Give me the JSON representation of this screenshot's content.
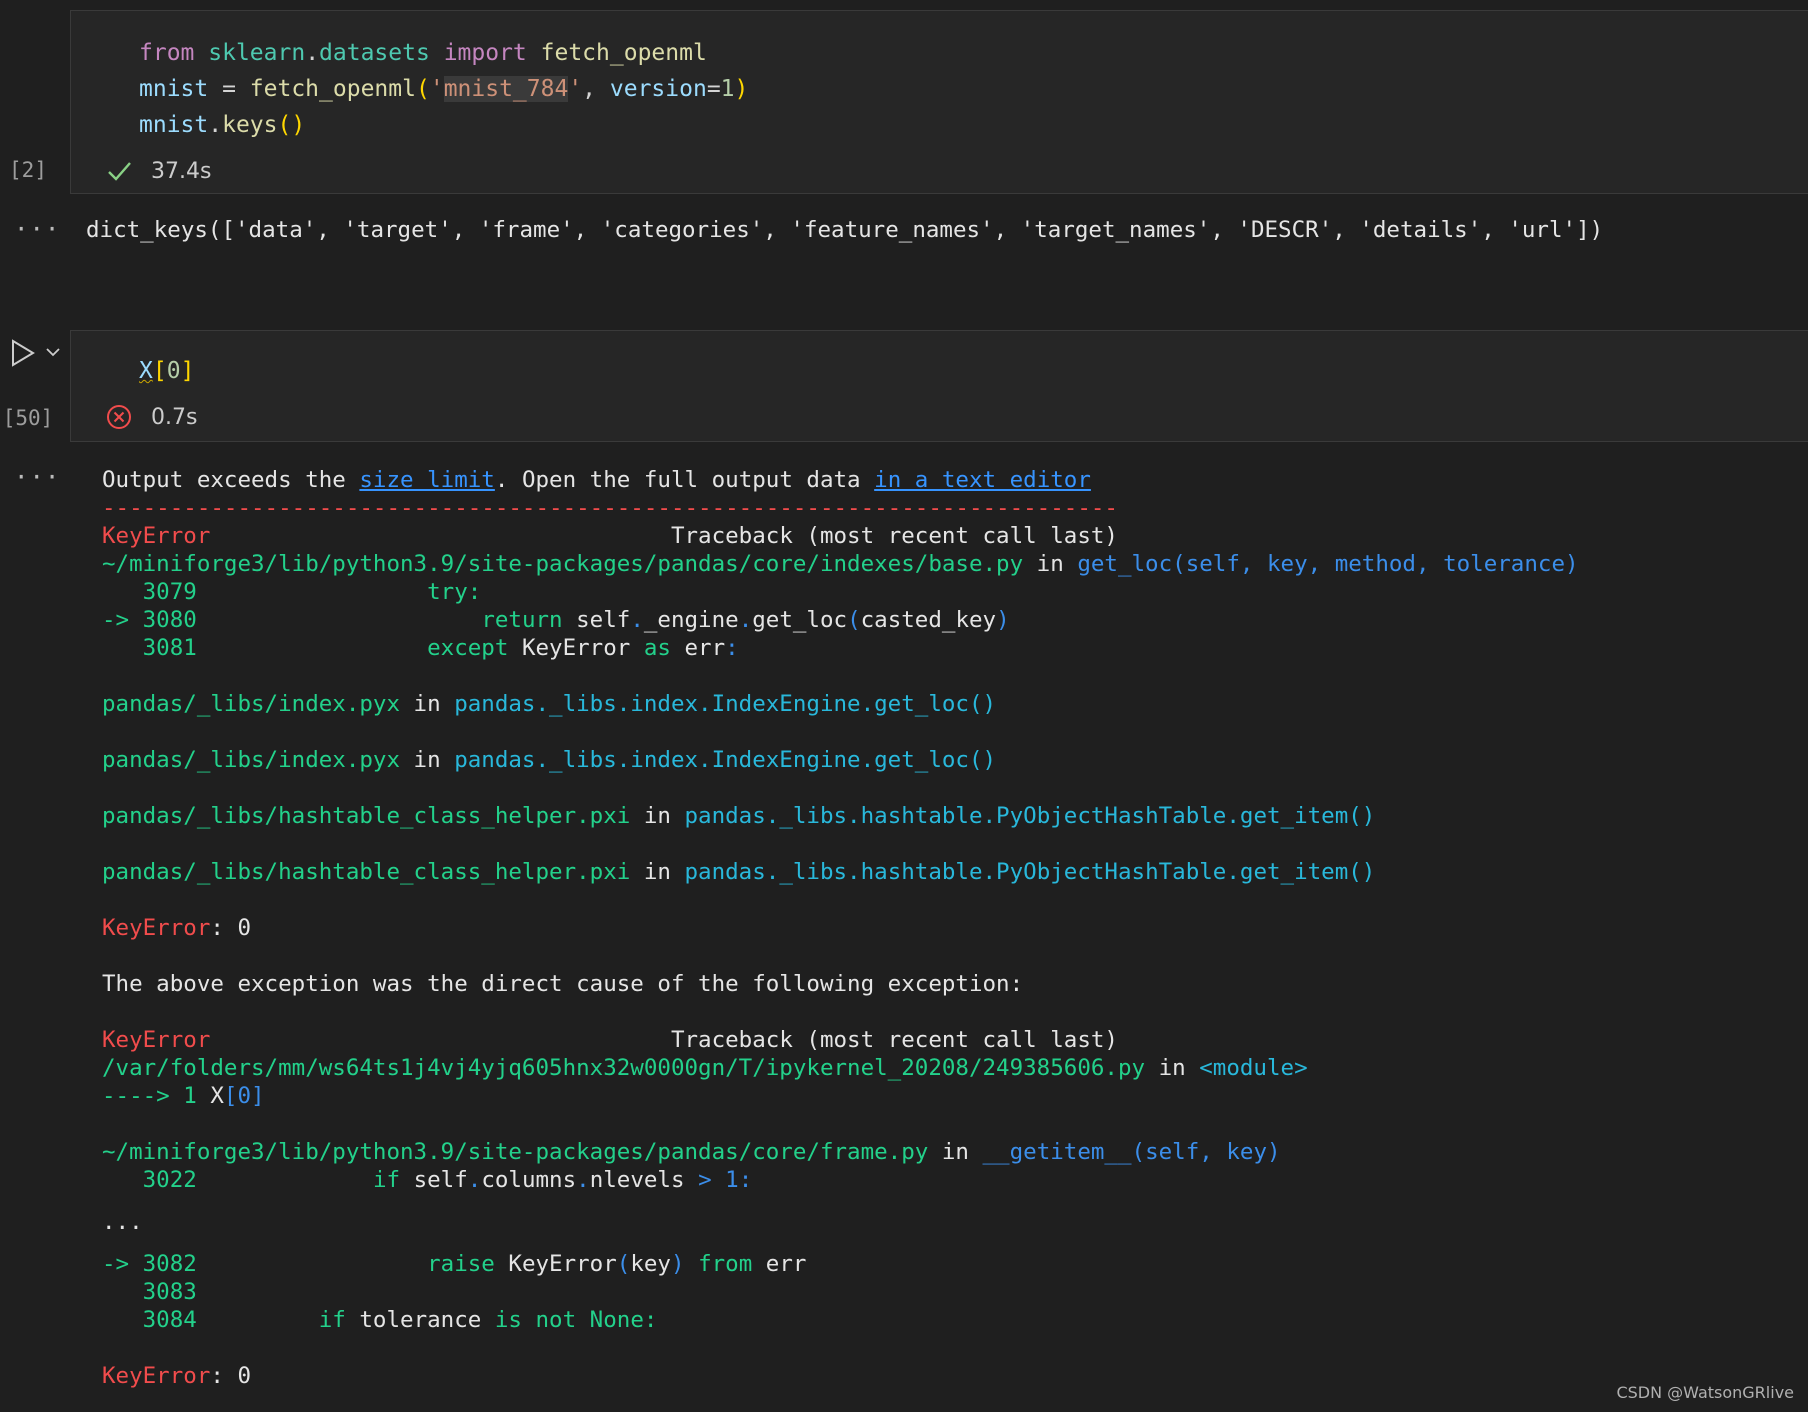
{
  "cell1": {
    "line1": {
      "from": "from",
      "module": "sklearn",
      "dot": ".",
      "sub": "datasets",
      "import": "import",
      "name": "fetch_openml"
    },
    "line2": {
      "var": "mnist",
      "eq": " = ",
      "fn": "fetch_openml",
      "open": "(",
      "quote1": "'",
      "arg": "mnist_784",
      "quote2": "'",
      "comma": ", ",
      "kwarg": "version",
      "eq2": "=",
      "num": "1",
      "close": ")"
    },
    "line3": {
      "var": "mnist",
      "dot": ".",
      "fn": "keys",
      "parens": "()"
    },
    "count": "[2]",
    "status_icon": "check-icon",
    "time": "37.4s"
  },
  "output1": {
    "ellipsis": "···",
    "text": "dict_keys(['data', 'target', 'frame', 'categories', 'feature_names', 'target_names', 'DESCR', 'details', 'url'])"
  },
  "cell2": {
    "code_x": "X",
    "code_bracket_open": "[",
    "code_num": "0",
    "code_bracket_close": "]",
    "count": "[50]",
    "status_icon": "error-circle-icon",
    "time": "0.7s",
    "run_icon": "play-icon",
    "chevron_icon": "chevron-down-icon"
  },
  "output2": {
    "ellipsis": "···",
    "notice": {
      "pre": "Output exceeds the ",
      "link1": "size limit",
      "mid": ". Open the full output data ",
      "link2": "in a text editor"
    },
    "separator": "---------------------------------------------------------------------------",
    "tb1": {
      "err": "KeyError",
      "gap": "                                  ",
      "head": "Traceback (most recent call last)"
    },
    "base_path": {
      "path": "~/miniforge3/lib/python3.9/site-packages/pandas/core/indexes/base.py",
      "in": " in ",
      "fn": "get_loc(self, key, method, tolerance)"
    },
    "l3079": {
      "num": "   3079",
      "gap": "                 ",
      "code": "try:"
    },
    "l3080": {
      "arrow": "-> 3080",
      "gap": "                     ",
      "kw": "return",
      "sp": " ",
      "obj": "self",
      "dot": ".",
      "attr": "_engine",
      "dot2": ".",
      "call": "get_loc",
      "open": "(",
      "arg": "casted_key",
      "close": ")"
    },
    "l3081": {
      "num": "   3081",
      "gap": "                 ",
      "kw": "except",
      "sp": " ",
      "name": "KeyError",
      "sp2": " ",
      "as": "as",
      "sp3": " ",
      "var": "err",
      "colon": ":"
    },
    "idx1": {
      "file": "pandas/_libs/index.pyx",
      "in": " in ",
      "fn": "pandas._libs.index.IndexEngine.get_loc()"
    },
    "idx2": {
      "file": "pandas/_libs/index.pyx",
      "in": " in ",
      "fn": "pandas._libs.index.IndexEngine.get_loc()"
    },
    "hash1": {
      "file": "pandas/_libs/hashtable_class_helper.pxi",
      "in": " in ",
      "fn": "pandas._libs.hashtable.PyObjectHashTable.get_item()"
    },
    "hash2": {
      "file": "pandas/_libs/hashtable_class_helper.pxi",
      "in": " in ",
      "fn": "pandas._libs.hashtable.PyObjectHashTable.get_item()"
    },
    "ke1": {
      "err": "KeyError",
      "rest": ": 0"
    },
    "cause": "The above exception was the direct cause of the following exception:",
    "tb2": {
      "err": "KeyError",
      "gap": "                                  ",
      "head": "Traceback (most recent call last)"
    },
    "tmp_path": {
      "path": "/var/folders/mm/ws64ts1j4vj4yjq605hnx32w0000gn/T/ipykernel_20208/249385606.py",
      "in": " in ",
      "fn": "<module>"
    },
    "arrow1": {
      "arrow": "----> 1 ",
      "x": "X",
      "bracket": "[0]"
    },
    "frame_path": {
      "path": "~/miniforge3/lib/python3.9/site-packages/pandas/core/frame.py",
      "in": " in ",
      "fn": "__getitem__(self, key)"
    },
    "l3022": {
      "num": "   3022",
      "gap": "             ",
      "kw": "if",
      "sp": " ",
      "obj": "self",
      "dot": ".",
      "attr": "columns",
      "dot2": ".",
      "attr2": "nlevels",
      "sp2": " ",
      "op": "> 1:"
    },
    "dots": "...",
    "l3082": {
      "arrow": "-> 3082",
      "gap": "                 ",
      "kw": "raise",
      "sp": " ",
      "name": "KeyError",
      "open": "(",
      "arg": "key",
      "close": ")",
      "sp2": " ",
      "from": "from",
      "sp3": " ",
      "var": "err"
    },
    "l3083": "   3083",
    "l3084": {
      "num": "   3084",
      "gap": "         ",
      "kw": "if",
      "sp": " ",
      "var": "tolerance",
      "sp2": " ",
      "op": "is not None:"
    },
    "ke2": {
      "err": "KeyError",
      "rest": ": 0"
    }
  },
  "watermark": "CSDN @WatsonGRlive",
  "colors": {
    "background": "#1f1f1f",
    "cell": "#262626",
    "error_red": "#f14c4c",
    "trace_green": "#23d18b",
    "trace_cyan": "#29b8db",
    "link_blue": "#3794ff"
  }
}
